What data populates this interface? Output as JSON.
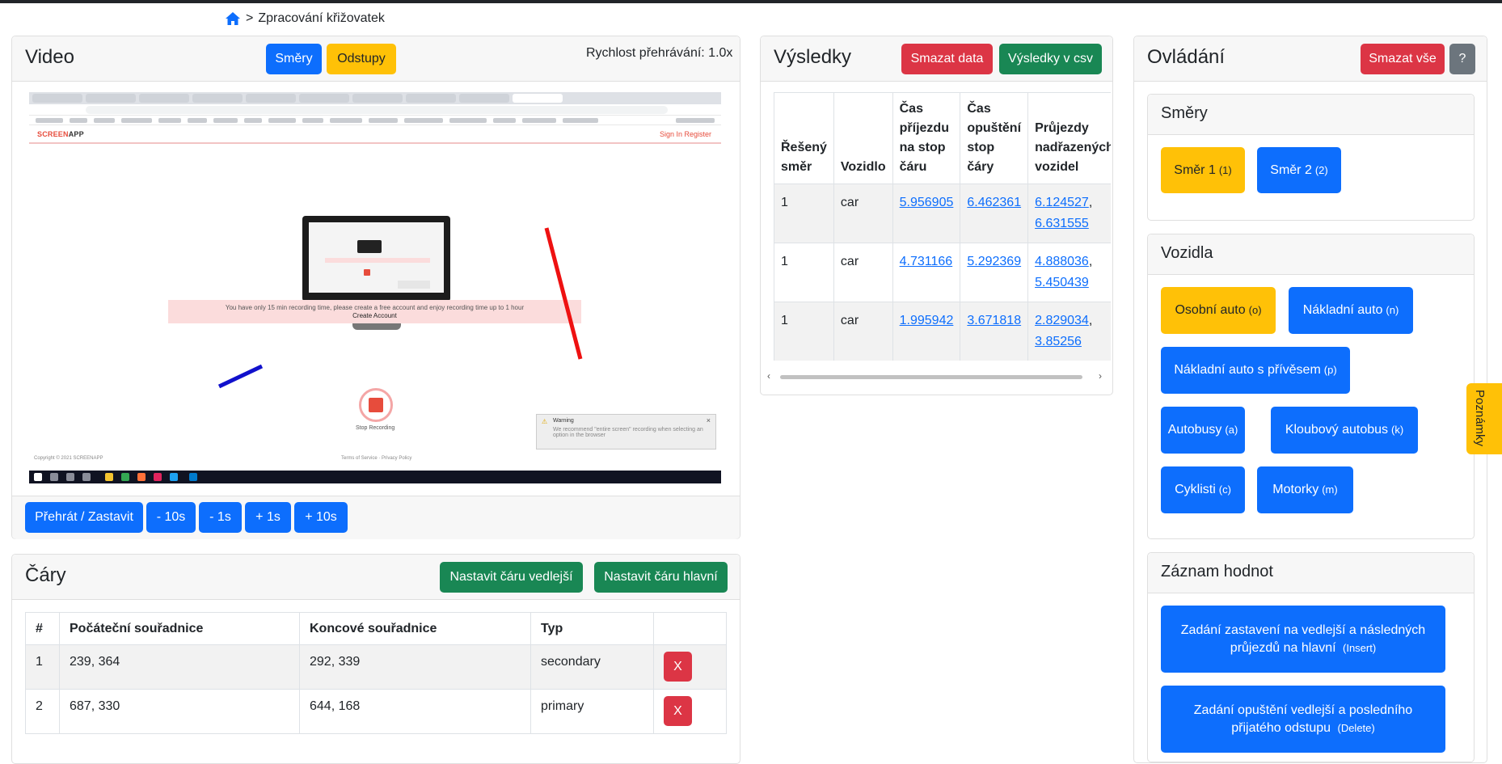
{
  "breadcrumb": {
    "separator": ">",
    "current": "Zpracování křižovatek"
  },
  "video": {
    "title": "Video",
    "buttons": {
      "directions": "Směry",
      "gaps": "Odstupy"
    },
    "speed_label": "Rychlost přehrávání: 1.0x",
    "frame": {
      "logo_main": "SCREEN",
      "logo_accent": "APP",
      "links": "Sign In    Register",
      "banner_text": "You have only 15 min recording time, please create a free account and enjoy recording time up to 1 hour",
      "banner_action": "Create Account",
      "stop_label": "Stop Recording",
      "warning_title": "Warning",
      "warning_body": "We recommend \"entire screen\" recording when selecting an option in the browser",
      "footer_left": "Copyright © 2021 SCREENAPP",
      "footer_mid": "Terms of Service · Privacy Policy"
    },
    "controls": {
      "play": "Přehrát / Zastavit",
      "back10": "- 10s",
      "back1": "- 1s",
      "fwd1": "+ 1s",
      "fwd10": "+ 10s"
    }
  },
  "lines": {
    "title": "Čáry",
    "buttons": {
      "set_secondary": "Nastavit čáru vedlejší",
      "set_primary": "Nastavit čáru hlavní"
    },
    "columns": [
      "#",
      "Počáteční souřadnice",
      "Koncové souřadnice",
      "Typ",
      ""
    ],
    "rows": [
      {
        "id": "1",
        "start": "239, 364",
        "end": "292, 339",
        "type": "secondary",
        "delete": "X"
      },
      {
        "id": "2",
        "start": "687, 330",
        "end": "644, 168",
        "type": "primary",
        "delete": "X"
      }
    ]
  },
  "results": {
    "title": "Výsledky",
    "buttons": {
      "clear": "Smazat data",
      "csv": "Výsledky v csv"
    },
    "columns": [
      "Řešený směr",
      "Vozidlo",
      "Čas příjezdu na stop čáru",
      "Čas opuštění stop čáry",
      "Průjezdy nadřazených vozidel"
    ],
    "rows": [
      {
        "direction": "1",
        "vehicle": "car",
        "arrival": "5.956905",
        "leave": "6.462361",
        "passes_a": "6.124527",
        "passes_b": "6.631555"
      },
      {
        "direction": "1",
        "vehicle": "car",
        "arrival": "4.731166",
        "leave": "5.292369",
        "passes_a": "4.888036",
        "passes_b": "5.450439"
      },
      {
        "direction": "1",
        "vehicle": "car",
        "arrival": "1.995942",
        "leave": "3.671818",
        "passes_a": "2.829034",
        "passes_b": "3.85256"
      }
    ],
    "separator": ","
  },
  "controls_panel": {
    "title": "Ovládání",
    "buttons": {
      "clear_all": "Smazat vše",
      "help": "?"
    },
    "directions": {
      "title": "Směry",
      "items": [
        {
          "label": "Směr 1",
          "key": "(1)"
        },
        {
          "label": "Směr 2",
          "key": "(2)"
        }
      ]
    },
    "vehicles": {
      "title": "Vozidla",
      "items": [
        {
          "label": "Osobní auto",
          "key": "(o)"
        },
        {
          "label": "Nákladní auto",
          "key": "(n)"
        },
        {
          "label": "Nákladní auto s přívěsem",
          "key": "(p)"
        },
        {
          "label": "Autobusy",
          "key": "(a)"
        },
        {
          "label": "Kloubový autobus",
          "key": "(k)"
        },
        {
          "label": "Cyklisti",
          "key": "(c)"
        },
        {
          "label": "Motorky",
          "key": "(m)"
        }
      ]
    },
    "record": {
      "title": "Záznam hodnot",
      "btn1_label": "Zadání zastavení na vedlejší a následných průjezdů na hlavní",
      "btn1_key": "(Insert)",
      "btn2_label": "Zadání opuštění vedlejší a posledního přijatého odstupu",
      "btn2_key": "(Delete)"
    }
  },
  "notes_tab": "Poznámky",
  "colors": {
    "primary": "#0d6efd",
    "warning": "#ffc107",
    "danger": "#dc3545",
    "success": "#198754",
    "secondary": "#6c757d"
  }
}
